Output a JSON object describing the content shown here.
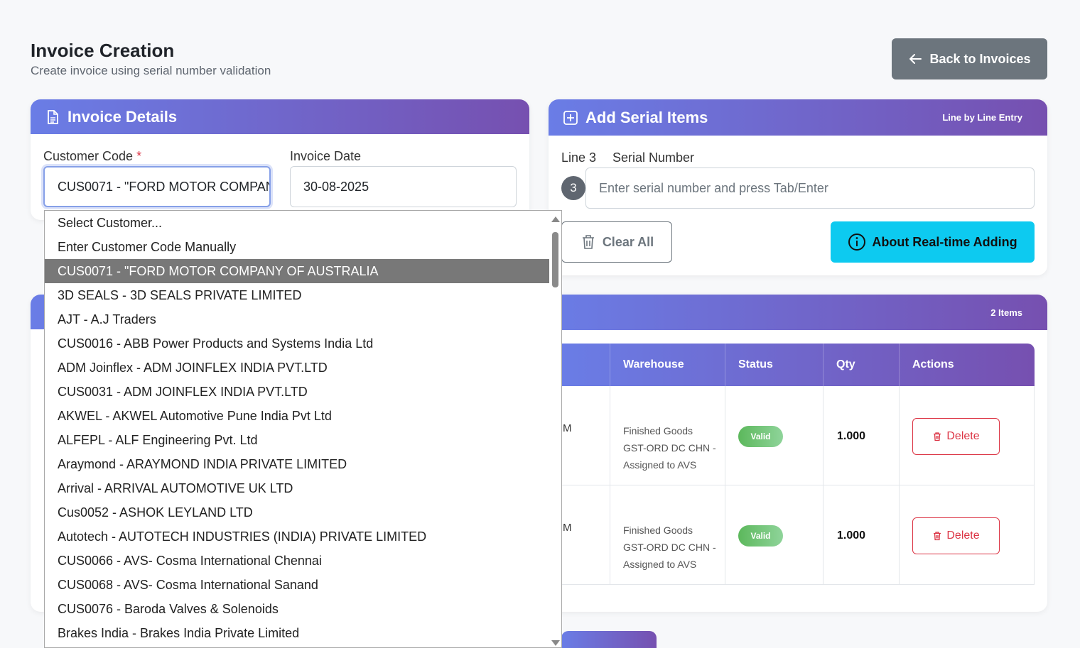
{
  "header": {
    "title": "Invoice Creation",
    "subtitle": "Create invoice using serial number validation",
    "back_button": "Back to Invoices"
  },
  "invoice_details": {
    "title": "Invoice Details",
    "customer_code_label": "Customer Code",
    "required_mark": "*",
    "customer_code_value": "CUS0071 - \"FORD MOTOR COMPANY OF AUSTRALIA",
    "invoice_date_label": "Invoice Date",
    "invoice_date_value": "30-08-2025"
  },
  "serial_items": {
    "title": "Add Serial Items",
    "badge": "Line by Line Entry",
    "line_label": "Line 3",
    "serial_label": "Serial Number",
    "line_number": "3",
    "serial_placeholder": "Enter serial number and press Tab/Enter",
    "clear_button": "Clear All",
    "about_button": "About Real-time Adding"
  },
  "items_table": {
    "count_badge": "2 Items",
    "columns": [
      "Warehouse",
      "Status",
      "Qty",
      "Actions"
    ],
    "rows": [
      {
        "name_fragment": "M",
        "warehouse": [
          "Finished Goods",
          "GST-ORD DC CHN -",
          "Assigned to AVS"
        ],
        "status": "Valid",
        "qty": "1.000",
        "action": "Delete"
      },
      {
        "name_fragment": "M",
        "warehouse": [
          "Finished Goods",
          "GST-ORD DC CHN -",
          "Assigned to AVS"
        ],
        "status": "Valid",
        "qty": "1.000",
        "action": "Delete"
      }
    ]
  },
  "customer_dropdown": {
    "selected_index": 2,
    "options": [
      "Select Customer...",
      "Enter Customer Code Manually",
      "CUS0071 - \"FORD MOTOR COMPANY OF AUSTRALIA",
      "3D SEALS - 3D SEALS PRIVATE LIMITED",
      "AJT - A.J Traders",
      "CUS0016 - ABB Power Products and Systems India Ltd",
      "ADM Joinflex - ADM JOINFLEX INDIA PVT.LTD",
      "CUS0031 - ADM JOINFLEX INDIA PVT.LTD",
      "AKWEL - AKWEL Automotive Pune India Pvt Ltd",
      "ALFEPL - ALF Engineering Pvt. Ltd",
      "Araymond - ARAYMOND INDIA PRIVATE LIMITED",
      "Arrival - ARRIVAL AUTOMOTIVE UK LTD",
      "Cus0052 - ASHOK LEYLAND LTD",
      "Autotech - AUTOTECH INDUSTRIES (INDIA) PRIVATE LIMITED",
      "CUS0066 - AVS- Cosma International Chennai",
      "CUS0068 - AVS- Cosma International Sanand",
      "CUS0076 - Baroda Valves & Solenoids",
      "Brakes India - Brakes India Private Limited"
    ]
  },
  "colors": {
    "header_gradient_start": "#6a7de6",
    "header_gradient_end": "#7650b0",
    "info_button": "#0dcaf0",
    "danger": "#dc3545",
    "secondary": "#6c757d"
  }
}
